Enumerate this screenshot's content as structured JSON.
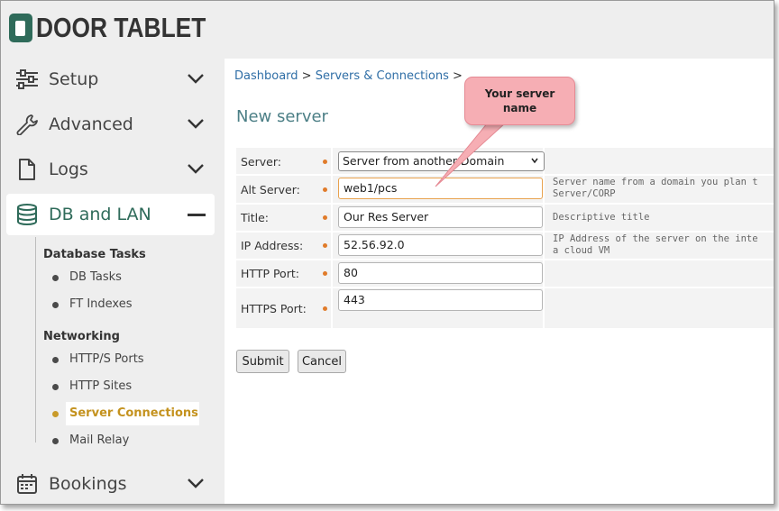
{
  "brand": {
    "name": "DOOR TABLET",
    "color": "#2f6b5a",
    "icon": "tablet-logo-icon"
  },
  "sidebar": {
    "items": [
      {
        "label": "Setup",
        "icon": "sliders-icon"
      },
      {
        "label": "Advanced",
        "icon": "wrench-icon"
      },
      {
        "label": "Logs",
        "icon": "document-icon"
      },
      {
        "label": "DB and LAN",
        "icon": "database-icon",
        "expanded": true
      },
      {
        "label": "Bookings",
        "icon": "calendar-icon"
      }
    ],
    "groups": [
      {
        "title": "Database Tasks",
        "items": [
          "DB Tasks",
          "FT Indexes"
        ]
      },
      {
        "title": "Networking",
        "items": [
          "HTTP/S Ports",
          "HTTP Sites",
          "Server Connections",
          "Mail Relay"
        ]
      }
    ],
    "active_subitem": "Server Connections",
    "accent": "#c4921e"
  },
  "breadcrumb": {
    "items": [
      "Dashboard",
      "Servers & Connections"
    ],
    "separator": ">"
  },
  "page_title": "New server",
  "form": {
    "rows": [
      {
        "label": "Server:",
        "type": "select",
        "value": "Server from another Domain",
        "help": ""
      },
      {
        "label": "Alt Server:",
        "type": "text",
        "value": "web1/pcs",
        "help": "Server name from a domain you plan t\nServer/CORP"
      },
      {
        "label": "Title:",
        "type": "text",
        "value": "Our Res Server",
        "help": "Descriptive title"
      },
      {
        "label": "IP Address:",
        "type": "text",
        "value": "52.56.92.0",
        "help": "IP Address of the server on the inte\na cloud VM"
      },
      {
        "label": "HTTP Port:",
        "type": "text",
        "value": "80",
        "help": ""
      },
      {
        "label": "HTTPS Port:",
        "type": "text",
        "value": "443",
        "help": ""
      }
    ],
    "submit_label": "Submit",
    "cancel_label": "Cancel"
  },
  "callout": {
    "text": "Your server name",
    "color": "#f6aeb4"
  }
}
